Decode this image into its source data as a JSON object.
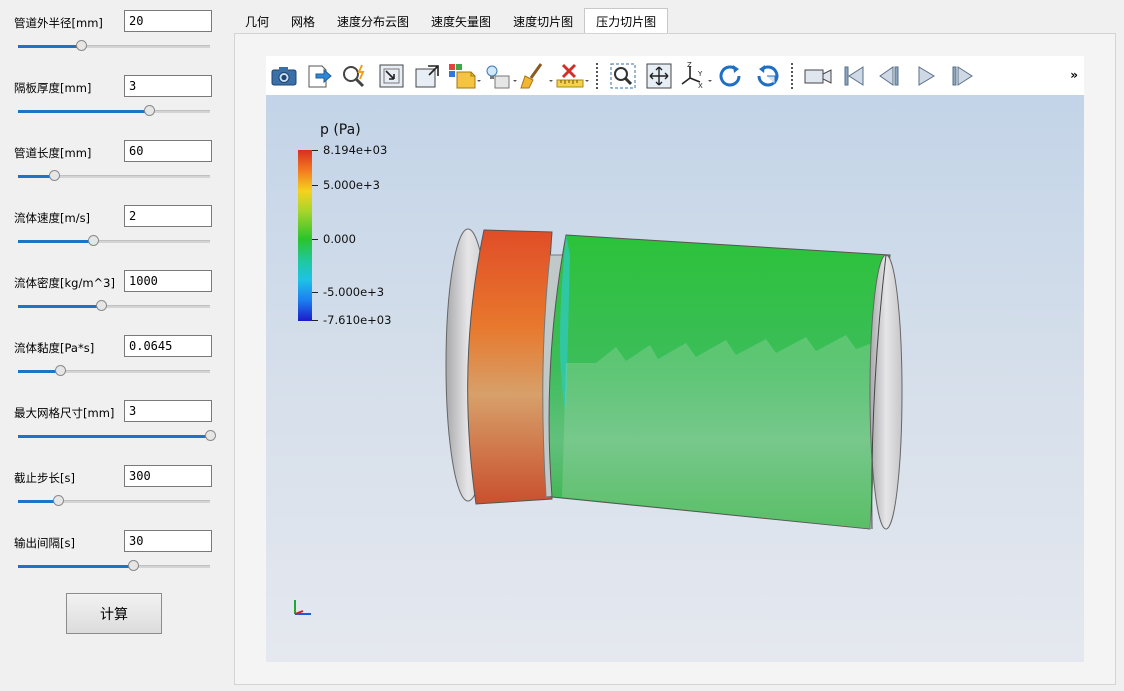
{
  "params": [
    {
      "label": "管道外半径[mm]",
      "value": "20",
      "slider": 0.33
    },
    {
      "label": "隔板厚度[mm]",
      "value": "3",
      "slider": 0.68
    },
    {
      "label": "管道长度[mm]",
      "value": "60",
      "slider": 0.19
    },
    {
      "label": "流体速度[m/s]",
      "value": "2",
      "slider": 0.39
    },
    {
      "label": "流体密度[kg/m^3]",
      "value": "1000",
      "slider": 0.43
    },
    {
      "label": "流体黏度[Pa*s]",
      "value": "0.0645",
      "slider": 0.22
    },
    {
      "label": "最大网格尺寸[mm]",
      "value": "3",
      "slider": 1.0
    },
    {
      "label": "截止步长[s]",
      "value": "300",
      "slider": 0.21
    },
    {
      "label": "输出间隔[s]",
      "value": "30",
      "slider": 0.6
    }
  ],
  "calc_button": "计算",
  "tabs": [
    "几何",
    "网格",
    "速度分布云图",
    "速度矢量图",
    "速度切片图",
    "压力切片图"
  ],
  "active_tab": 5,
  "toolbar_icons": [
    "camera-icon",
    "export-icon",
    "probe-icon",
    "reset-view-icon",
    "maximize-icon",
    "box-select-icon",
    "light-icon",
    "clear-icon",
    "ruler-delete-icon",
    "zoom-box-icon",
    "fit-view-icon",
    "axes-icon",
    "rotate-cw-icon",
    "rotate-ccw-icon",
    "camera-video-icon",
    "first-frame-icon",
    "previous-frame-icon",
    "play-icon",
    "last-frame-icon"
  ],
  "toolbar_more": "»",
  "legend": {
    "title": "p (Pa)",
    "labels": [
      "8.194e+03",
      "5.000e+3",
      "0.000",
      "-5.000e+3",
      "-7.610e+03"
    ]
  },
  "colors": {
    "accent": "#1e74c4",
    "max": "#d7301f",
    "zero": "#2bc42b",
    "min": "#1c1cc8"
  }
}
